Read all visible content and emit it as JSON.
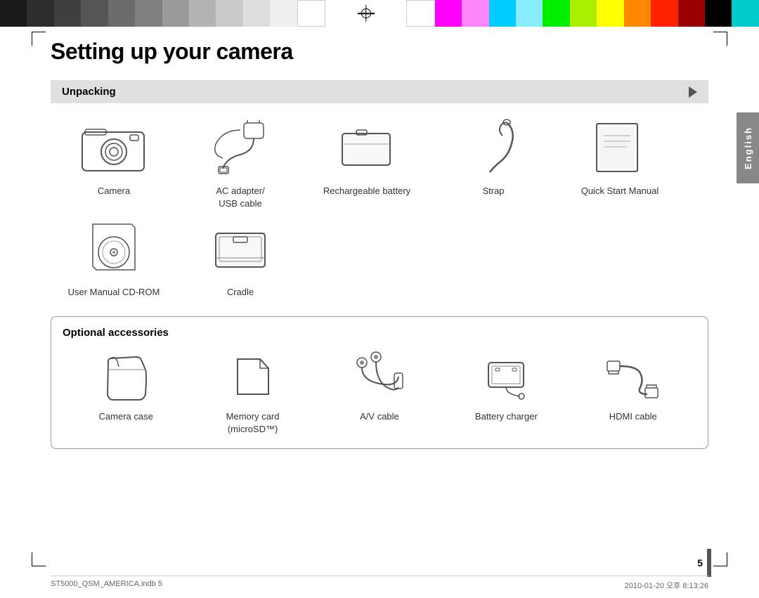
{
  "top_bar": {
    "colors_left": [
      "#1a1a1a",
      "#2d2d2d",
      "#3f3f3f",
      "#555555",
      "#6b6b6b",
      "#808080",
      "#999999",
      "#b3b3b3",
      "#cccccc",
      "#e0e0e0",
      "#f0f0f0",
      "#ffffff"
    ],
    "colors_right": [
      "#ff00ff",
      "#ff80ff",
      "#00ffff",
      "#80ffff",
      "#00ff00",
      "#80ff00",
      "#ffff00",
      "#ff8000",
      "#ff0000",
      "#cc0000",
      "#000000",
      "#00cccc"
    ]
  },
  "page": {
    "title": "Setting up your camera",
    "side_tab": "English",
    "page_number": "5"
  },
  "unpacking": {
    "section_title": "Unpacking",
    "items": [
      {
        "label": "Camera"
      },
      {
        "label": "AC adapter/\nUSB cable"
      },
      {
        "label": "Rechargeable battery"
      },
      {
        "label": "Strap"
      },
      {
        "label": "Quick Start Manual"
      },
      {
        "label": "User Manual CD-ROM"
      },
      {
        "label": "Cradle"
      }
    ]
  },
  "optional": {
    "section_title": "Optional accessories",
    "items": [
      {
        "label": "Camera case"
      },
      {
        "label": "Memory card\n(microSD™)"
      },
      {
        "label": "A/V cable"
      },
      {
        "label": "Battery charger"
      },
      {
        "label": "HDMI cable"
      }
    ]
  },
  "footer": {
    "left": "ST5000_QSM_AMERICA.indb   5",
    "right": "2010-01-20   오후 8:13:26"
  }
}
